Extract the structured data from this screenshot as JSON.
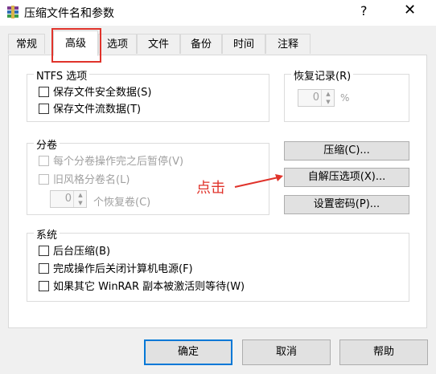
{
  "window": {
    "title": "压缩文件名和参数",
    "help_glyph": "?",
    "close_glyph": "✕"
  },
  "tabs": [
    {
      "label": "常规",
      "active": false
    },
    {
      "label": "高级",
      "active": true
    },
    {
      "label": "选项",
      "active": false
    },
    {
      "label": "文件",
      "active": false
    },
    {
      "label": "备份",
      "active": false
    },
    {
      "label": "时间",
      "active": false
    },
    {
      "label": "注释",
      "active": false
    }
  ],
  "ntfs": {
    "title": "NTFS 选项",
    "items": [
      {
        "label": "保存文件安全数据(S)",
        "checked": false
      },
      {
        "label": "保存文件流数据(T)",
        "checked": false
      }
    ]
  },
  "recovery": {
    "title": "恢复记录(R)",
    "value": "0",
    "unit": "%"
  },
  "volumes": {
    "title": "分卷",
    "items": [
      {
        "label": "每个分卷操作完之后暂停(V)",
        "checked": false,
        "disabled": true
      },
      {
        "label": "旧风格分卷名(L)",
        "checked": false,
        "disabled": true
      }
    ],
    "recovery_volumes_value": "0",
    "recovery_volumes_label": "个恢复卷(C)"
  },
  "side_buttons": {
    "compression": "压缩(C)...",
    "sfx": "自解压选项(X)...",
    "password": "设置密码(P)..."
  },
  "system": {
    "title": "系统",
    "items": [
      {
        "label": "后台压缩(B)",
        "checked": false
      },
      {
        "label": "完成操作后关闭计算机电源(F)",
        "checked": false
      },
      {
        "label": "如果其它 WinRAR 副本被激活则等待(W)",
        "checked": false
      }
    ]
  },
  "footer": {
    "ok": "确定",
    "cancel": "取消",
    "help": "帮助"
  },
  "annotation": {
    "text": "点击",
    "color": "#e0332b"
  },
  "colors": {
    "accent": "#0078d7",
    "highlight": "#e0332b"
  }
}
